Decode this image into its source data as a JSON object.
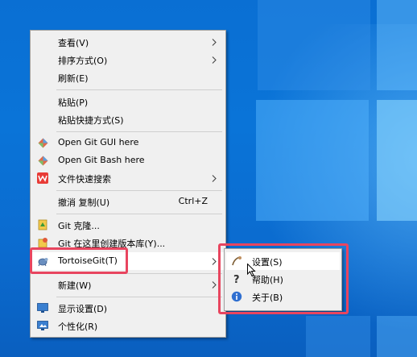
{
  "main_menu": {
    "items": [
      {
        "label": "查看(V)",
        "submenu": true
      },
      {
        "label": "排序方式(O)",
        "submenu": true
      },
      {
        "label": "刷新(E)"
      },
      {
        "label": "粘贴(P)"
      },
      {
        "label": "粘贴快捷方式(S)"
      },
      {
        "label": "Open Git GUI here",
        "icon": "git-diamond-icon"
      },
      {
        "label": "Open Git Bash here",
        "icon": "git-diamond-icon"
      },
      {
        "label": "文件快速搜索",
        "icon": "wps-icon",
        "submenu": true
      },
      {
        "label": "撤消 复制(U)",
        "shortcut": "Ctrl+Z"
      },
      {
        "label": "Git 克隆...",
        "icon": "git-clone-icon"
      },
      {
        "label": "Git 在这里创建版本库(Y)...",
        "icon": "git-create-repo-icon"
      },
      {
        "label": "TortoiseGit(T)",
        "icon": "tortoise-icon",
        "submenu": true
      },
      {
        "label": "新建(W)",
        "submenu": true
      },
      {
        "label": "显示设置(D)",
        "icon": "display-icon"
      },
      {
        "label": "个性化(R)",
        "icon": "personalize-icon"
      }
    ]
  },
  "submenu": {
    "items": [
      {
        "label": "设置(S)",
        "icon": "settings-tortoise-icon"
      },
      {
        "label": "帮助(H)",
        "icon": "help-icon"
      },
      {
        "label": "关于(B)",
        "icon": "info-icon"
      }
    ]
  },
  "colors": {
    "highlight_box": "#e8455f",
    "menu_bg": "#f0f0f0",
    "desktop_blue": "#0a74d8"
  }
}
